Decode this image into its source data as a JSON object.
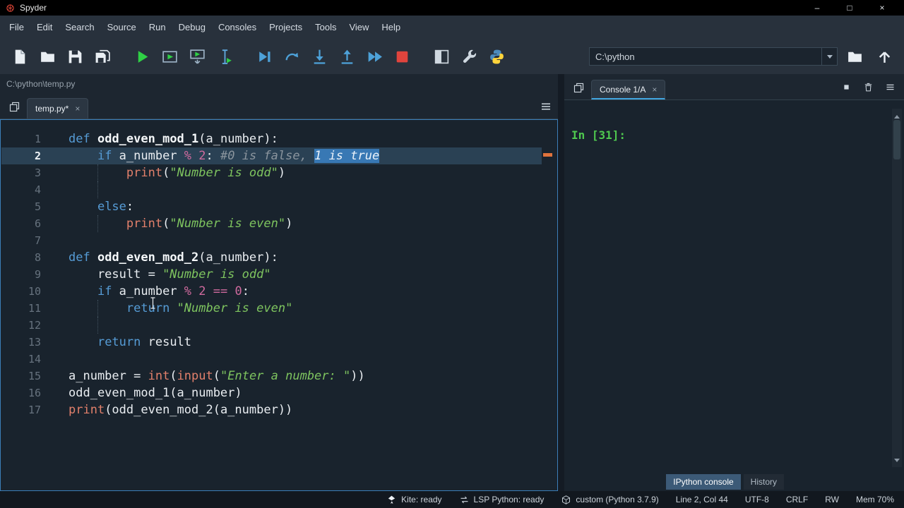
{
  "window": {
    "title": "Spyder",
    "controls": {
      "minimize": "–",
      "maximize": "□",
      "close": "×"
    }
  },
  "menubar": {
    "items": [
      "File",
      "Edit",
      "Search",
      "Source",
      "Run",
      "Debug",
      "Consoles",
      "Projects",
      "Tools",
      "View",
      "Help"
    ]
  },
  "toolbar": {
    "buttons": [
      {
        "name": "new-file-button",
        "icon": "new-file-icon"
      },
      {
        "name": "open-file-button",
        "icon": "open-folder-icon"
      },
      {
        "name": "save-button",
        "icon": "save-icon"
      },
      {
        "name": "save-all-button",
        "icon": "save-all-icon"
      },
      {
        "sep": true
      },
      {
        "name": "run-file-button",
        "icon": "run-file-icon"
      },
      {
        "name": "run-cell-button",
        "icon": "run-cell-icon"
      },
      {
        "name": "run-cell-advance-button",
        "icon": "run-cell-advance-icon"
      },
      {
        "name": "run-selection-button",
        "icon": "run-selection-icon"
      },
      {
        "sep": true
      },
      {
        "name": "debug-file-button",
        "icon": "debug-file-icon"
      },
      {
        "name": "step-over-button",
        "icon": "step-over-icon"
      },
      {
        "name": "step-into-button",
        "icon": "step-into-icon"
      },
      {
        "name": "step-out-button",
        "icon": "step-out-icon"
      },
      {
        "name": "continue-button",
        "icon": "continue-icon"
      },
      {
        "name": "stop-button",
        "icon": "stop-icon"
      },
      {
        "sep": true
      },
      {
        "name": "maximize-pane-button",
        "icon": "maximize-pane-icon"
      },
      {
        "name": "preferences-button",
        "icon": "preferences-icon"
      },
      {
        "name": "pythonpath-button",
        "icon": "pythonpath-icon"
      }
    ],
    "working_dir": {
      "value": "C:\\python"
    }
  },
  "editor": {
    "path": "C:\\python\\temp.py",
    "tab": {
      "label": "temp.py*",
      "close": "×"
    },
    "lines": [
      {
        "n": "1",
        "tokens": [
          {
            "t": "def",
            "c": "kw"
          },
          {
            "t": " ",
            "c": "txt"
          },
          {
            "t": "odd_even_mod_1",
            "c": "fn"
          },
          {
            "t": "(a_number):",
            "c": "txt"
          }
        ]
      },
      {
        "n": "2",
        "current": true,
        "tokens": [
          {
            "t": "    ",
            "c": "txt"
          },
          {
            "t": "if",
            "c": "kw"
          },
          {
            "t": " a_number ",
            "c": "txt"
          },
          {
            "t": "%",
            "c": "op"
          },
          {
            "t": " ",
            "c": "txt"
          },
          {
            "t": "2",
            "c": "num"
          },
          {
            "t": ": ",
            "c": "txt"
          },
          {
            "t": "#0 is false, ",
            "c": "cmt"
          },
          {
            "t": "1 is true",
            "c": "cmt",
            "sel": true
          }
        ]
      },
      {
        "n": "3",
        "g": [
          4
        ],
        "tokens": [
          {
            "t": "        ",
            "c": "txt"
          },
          {
            "t": "print",
            "c": "bi"
          },
          {
            "t": "(",
            "c": "txt"
          },
          {
            "t": "\"Number is odd\"",
            "c": "str"
          },
          {
            "t": ")",
            "c": "txt"
          }
        ]
      },
      {
        "n": "4",
        "g": [
          4
        ],
        "tokens": []
      },
      {
        "n": "5",
        "tokens": [
          {
            "t": "    ",
            "c": "txt"
          },
          {
            "t": "else",
            "c": "kw"
          },
          {
            "t": ":",
            "c": "txt"
          }
        ]
      },
      {
        "n": "6",
        "g": [
          4
        ],
        "tokens": [
          {
            "t": "        ",
            "c": "txt"
          },
          {
            "t": "print",
            "c": "bi"
          },
          {
            "t": "(",
            "c": "txt"
          },
          {
            "t": "\"Number is even\"",
            "c": "str"
          },
          {
            "t": ")",
            "c": "txt"
          }
        ]
      },
      {
        "n": "7",
        "tokens": []
      },
      {
        "n": "8",
        "tokens": [
          {
            "t": "def",
            "c": "kw"
          },
          {
            "t": " ",
            "c": "txt"
          },
          {
            "t": "odd_even_mod_2",
            "c": "fn"
          },
          {
            "t": "(a_number):",
            "c": "txt"
          }
        ]
      },
      {
        "n": "9",
        "tokens": [
          {
            "t": "    result = ",
            "c": "txt"
          },
          {
            "t": "\"Number is odd\"",
            "c": "str"
          }
        ]
      },
      {
        "n": "10",
        "tokens": [
          {
            "t": "    ",
            "c": "txt"
          },
          {
            "t": "if",
            "c": "kw"
          },
          {
            "t": " a_number ",
            "c": "txt"
          },
          {
            "t": "%",
            "c": "op"
          },
          {
            "t": " ",
            "c": "txt"
          },
          {
            "t": "2",
            "c": "num"
          },
          {
            "t": " ",
            "c": "txt"
          },
          {
            "t": "==",
            "c": "op"
          },
          {
            "t": " ",
            "c": "txt"
          },
          {
            "t": "0",
            "c": "num"
          },
          {
            "t": ":",
            "c": "txt"
          }
        ]
      },
      {
        "n": "11",
        "g": [
          4
        ],
        "tokens": [
          {
            "t": "        ",
            "c": "txt"
          },
          {
            "t": "return",
            "c": "kw"
          },
          {
            "t": " ",
            "c": "txt"
          },
          {
            "t": "\"Number is even\"",
            "c": "str"
          }
        ]
      },
      {
        "n": "12",
        "g": [
          4
        ],
        "tokens": []
      },
      {
        "n": "13",
        "tokens": [
          {
            "t": "    ",
            "c": "txt"
          },
          {
            "t": "return",
            "c": "kw"
          },
          {
            "t": " result",
            "c": "txt"
          }
        ]
      },
      {
        "n": "14",
        "tokens": []
      },
      {
        "n": "15",
        "tokens": [
          {
            "t": "a_number = ",
            "c": "txt"
          },
          {
            "t": "int",
            "c": "bi"
          },
          {
            "t": "(",
            "c": "txt"
          },
          {
            "t": "input",
            "c": "bi"
          },
          {
            "t": "(",
            "c": "txt"
          },
          {
            "t": "\"Enter a number: \"",
            "c": "str"
          },
          {
            "t": "))",
            "c": "txt"
          }
        ]
      },
      {
        "n": "16",
        "tokens": [
          {
            "t": "odd_even_mod_1(a_number)",
            "c": "txt"
          }
        ]
      },
      {
        "n": "17",
        "tokens": [
          {
            "t": "print",
            "c": "bi"
          },
          {
            "t": "(odd_even_mod_2(a_number))",
            "c": "txt"
          }
        ]
      }
    ]
  },
  "console": {
    "tab": {
      "label": "Console 1/A",
      "close": "×"
    },
    "prompt": "In [31]:",
    "bottom_tabs": [
      {
        "label": "IPython console",
        "active": true
      },
      {
        "label": "History",
        "active": false
      }
    ]
  },
  "statusbar": {
    "items": [
      {
        "icon": "kite-icon",
        "label": "Kite: ready",
        "name": "kite-status",
        "clickable": true
      },
      {
        "icon": "lsp-icon",
        "label": "LSP Python: ready",
        "name": "lsp-status",
        "clickable": true
      },
      {
        "icon": "python-env-icon",
        "label": "custom (Python 3.7.9)",
        "name": "interpreter-status",
        "clickable": true
      },
      {
        "label": "Line 2, Col 44",
        "name": "cursor-position",
        "clickable": false
      },
      {
        "label": "UTF-8",
        "name": "encoding-status",
        "clickable": false
      },
      {
        "label": "CRLF",
        "name": "eol-status",
        "clickable": false
      },
      {
        "label": "RW",
        "name": "readwrite-status",
        "clickable": false
      },
      {
        "label": "Mem 70%",
        "name": "memory-status",
        "clickable": false
      }
    ]
  },
  "colors": {
    "accent_blue": "#3c7eb8",
    "run_green": "#2fd045",
    "stop_red": "#e0443d",
    "selection_blue": "#3878b4",
    "current_line": "#2a4154",
    "prompt_green": "#4fc94f"
  }
}
